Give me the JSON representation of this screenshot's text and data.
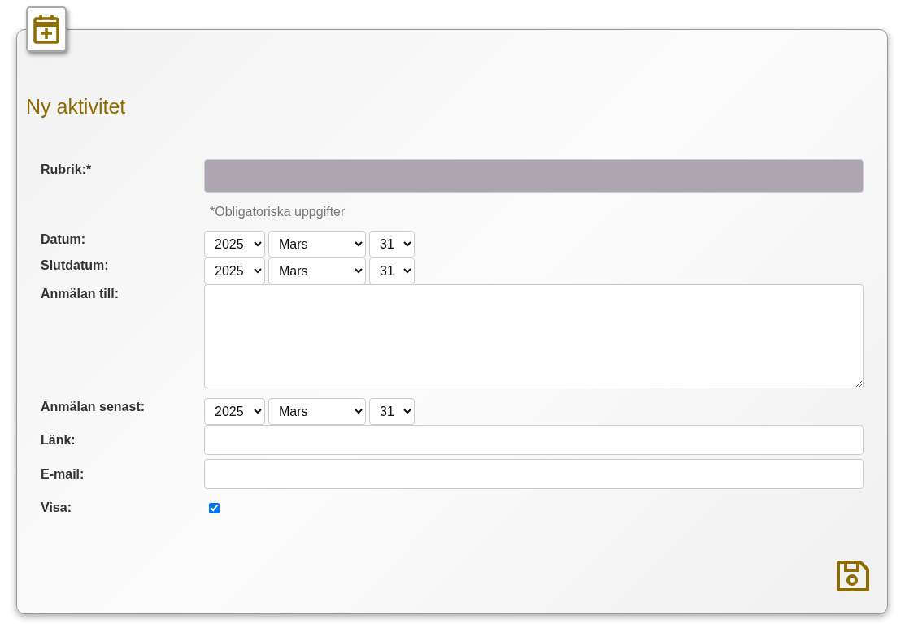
{
  "title": "Ny aktivitet",
  "fields": [
    {
      "kind": "text",
      "label": "Rubrik:*",
      "highlighted": true
    },
    {
      "kind": "note",
      "text": "*Obligatoriska uppgifter"
    },
    {
      "kind": "date",
      "label": "Datum:",
      "year": "2025",
      "month": "Mars",
      "day": "31"
    },
    {
      "kind": "date",
      "label": "Slutdatum:",
      "year": "2025",
      "month": "Mars",
      "day": "31"
    },
    {
      "kind": "textarea",
      "label": "Anmälan till:"
    },
    {
      "kind": "date",
      "label": "Anmälan senast:",
      "year": "2025",
      "month": "Mars",
      "day": "31"
    },
    {
      "kind": "text",
      "label": "Länk:",
      "highlighted": false
    },
    {
      "kind": "text",
      "label": "E-mail:",
      "highlighted": false
    },
    {
      "kind": "checkbox",
      "label": "Visa:",
      "checked": true
    }
  ]
}
